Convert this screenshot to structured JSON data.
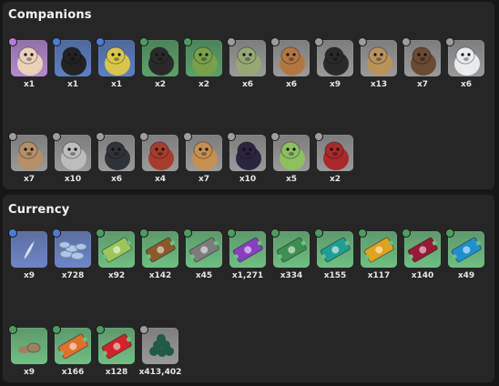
{
  "companions": {
    "title": "Companions",
    "rows": [
      [
        {
          "name": "red-panda",
          "count": "x1",
          "bg": "#b58ad0",
          "fg": "#e9d2b8",
          "badge": "#b77bd8"
        },
        {
          "name": "black-cat",
          "count": "x1",
          "bg": "#5d7fc4",
          "fg": "#222222",
          "badge": "#4e7bd8"
        },
        {
          "name": "serpent",
          "count": "x1",
          "bg": "#5d7fc4",
          "fg": "#d9c64a",
          "badge": "#4e7bd8"
        },
        {
          "name": "black-bear",
          "count": "x2",
          "bg": "#5aa26b",
          "fg": "#2a2a2a",
          "badge": "#4f9b5f"
        },
        {
          "name": "frog",
          "count": "x2",
          "bg": "#5aa26b",
          "fg": "#7aa04a",
          "badge": "#4f9b5f"
        },
        {
          "name": "toad",
          "count": "x6",
          "bg": "#9a9a9a",
          "fg": "#96a873",
          "badge": "#9d9d9d"
        },
        {
          "name": "brown-bear",
          "count": "x6",
          "bg": "#9a9a9a",
          "fg": "#b27740",
          "badge": "#9d9d9d"
        },
        {
          "name": "bumblebee",
          "count": "x9",
          "bg": "#9a9a9a",
          "fg": "#2a2a2a",
          "badge": "#9d9d9d"
        },
        {
          "name": "weasel",
          "count": "x13",
          "bg": "#9a9a9a",
          "fg": "#b9925c",
          "badge": "#9d9d9d"
        },
        {
          "name": "kiwi",
          "count": "x7",
          "bg": "#9a9a9a",
          "fg": "#6a4a34",
          "badge": "#9d9d9d"
        },
        {
          "name": "white-wolf",
          "count": "x6",
          "bg": "#9a9a9a",
          "fg": "#e8ecef",
          "badge": "#9d9d9d"
        }
      ],
      [
        {
          "name": "deer",
          "count": "x7",
          "bg": "#9a9a9a",
          "fg": "#b58f66",
          "badge": "#9d9d9d"
        },
        {
          "name": "robot-pig",
          "count": "x10",
          "bg": "#9a9a9a",
          "fg": "#bdbdbd",
          "badge": "#9d9d9d"
        },
        {
          "name": "crow",
          "count": "x6",
          "bg": "#9a9a9a",
          "fg": "#2f3238",
          "badge": "#9d9d9d"
        },
        {
          "name": "red-lion",
          "count": "x4",
          "bg": "#9a9a9a",
          "fg": "#a63d2c",
          "badge": "#9d9d9d"
        },
        {
          "name": "lion",
          "count": "x7",
          "bg": "#9a9a9a",
          "fg": "#c69050",
          "badge": "#9d9d9d"
        },
        {
          "name": "black-panther",
          "count": "x10",
          "bg": "#9a9a9a",
          "fg": "#2b2540",
          "badge": "#9d9d9d"
        },
        {
          "name": "mantis",
          "count": "x5",
          "bg": "#9a9a9a",
          "fg": "#8ec060",
          "badge": "#9d9d9d"
        },
        {
          "name": "red-wolf",
          "count": "x2",
          "bg": "#9a9a9a",
          "fg": "#a82a2a",
          "badge": "#9d9d9d"
        }
      ]
    ]
  },
  "currency": {
    "title": "Currency",
    "rows": [
      [
        {
          "name": "feather",
          "count": "x9",
          "bg": "#6d86c9",
          "fg": "#dde4f2",
          "badge": "#4e7bd8"
        },
        {
          "name": "coins",
          "count": "x728",
          "bg": "#6d86c9",
          "fg": "#aec6e8",
          "badge": "#4e7bd8"
        },
        {
          "name": "ticket-green",
          "count": "x92",
          "bg": "#6fbf83",
          "fg": "#9cc85a",
          "badge": "#4f9b5f"
        },
        {
          "name": "ticket-brown",
          "count": "x142",
          "bg": "#6fbf83",
          "fg": "#8b5a2b",
          "badge": "#4f9b5f"
        },
        {
          "name": "ticket-gray",
          "count": "x45",
          "bg": "#6fbf83",
          "fg": "#7c7c7c",
          "badge": "#4f9b5f"
        },
        {
          "name": "ticket-purple",
          "count": "x1,271",
          "bg": "#6fbf83",
          "fg": "#8a3fc2",
          "badge": "#4f9b5f"
        },
        {
          "name": "ticket-leaf",
          "count": "x334",
          "bg": "#6fbf83",
          "fg": "#3f8f52",
          "badge": "#4f9b5f"
        },
        {
          "name": "ticket-teal",
          "count": "x155",
          "bg": "#6fbf83",
          "fg": "#1f9e94",
          "badge": "#4f9b5f"
        },
        {
          "name": "ticket-gold",
          "count": "x117",
          "bg": "#6fbf83",
          "fg": "#e3a21a",
          "badge": "#4f9b5f"
        },
        {
          "name": "ticket-crimson",
          "count": "x140",
          "bg": "#6fbf83",
          "fg": "#9a1833",
          "badge": "#4f9b5f"
        },
        {
          "name": "ticket-sky",
          "count": "x49",
          "bg": "#6fbf83",
          "fg": "#1f8fd0",
          "badge": "#4f9b5f"
        }
      ],
      [
        {
          "name": "mushroom",
          "count": "x9",
          "bg": "#6fbf83",
          "fg": "#a08060",
          "badge": "#4f9b5f"
        },
        {
          "name": "ticket-orange",
          "count": "x166",
          "bg": "#6fbf83",
          "fg": "#e0702a",
          "badge": "#4f9b5f"
        },
        {
          "name": "ticket-red",
          "count": "x128",
          "bg": "#6fbf83",
          "fg": "#d6212a",
          "badge": "#4f9b5f"
        },
        {
          "name": "gems",
          "count": "x413,402",
          "bg": "#9a9a9a",
          "fg": "#1f5a44",
          "badge": "#9d9d9d"
        }
      ]
    ]
  }
}
